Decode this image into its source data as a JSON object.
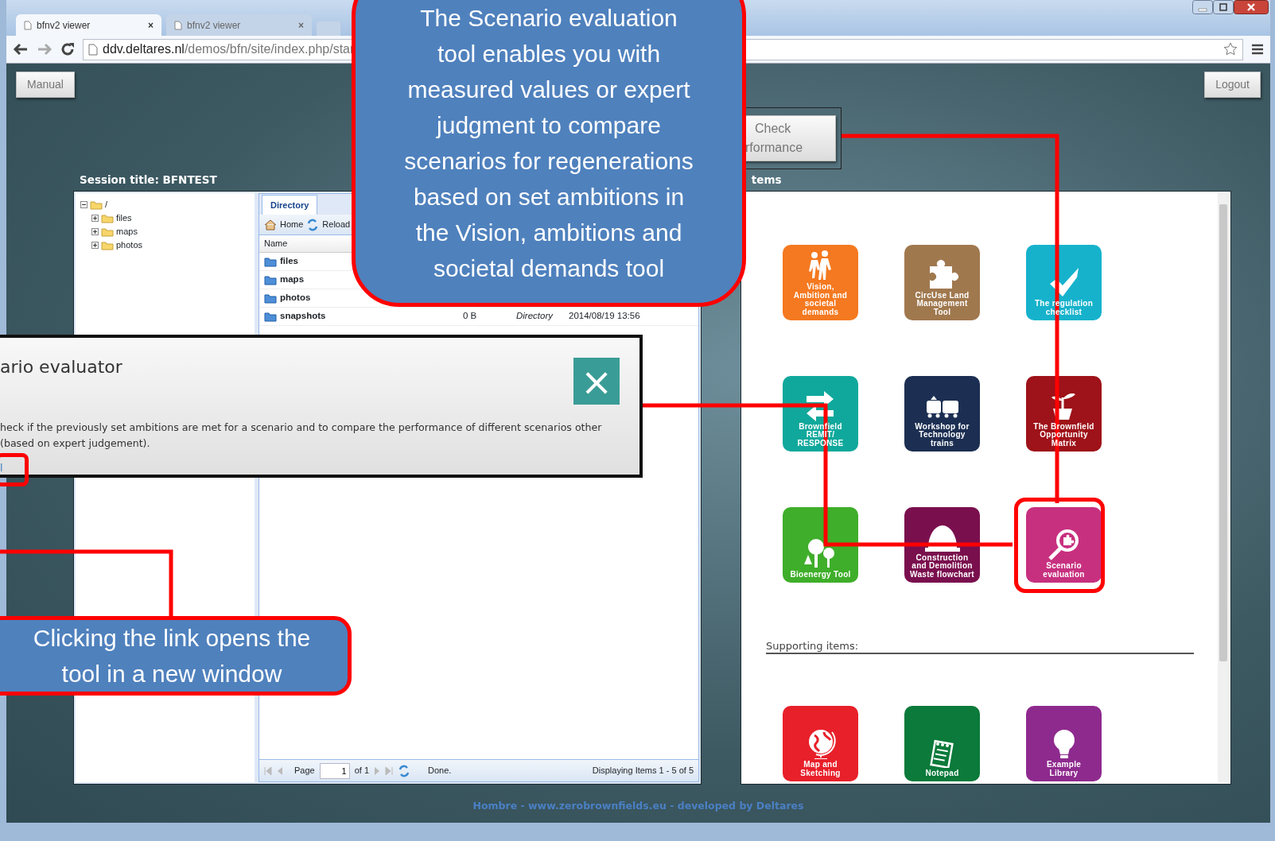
{
  "browser": {
    "tabs": [
      {
        "title": "bfnv2 viewer",
        "close": "×",
        "selected": true
      },
      {
        "title": "bfnv2 viewer",
        "close": "×",
        "selected": false
      }
    ],
    "url_host": "ddv.deltares.nl",
    "url_path": "/demos/bfn/site/index.php/star"
  },
  "header": {
    "manual": "Manual",
    "logout": "Logout",
    "check_performance": [
      "Check",
      "rformance"
    ]
  },
  "session_title": "Session title: BFNTEST",
  "items_heading": "tems",
  "tree": {
    "label": "/",
    "expanded": true,
    "children": [
      {
        "label": "files",
        "expanded": false
      },
      {
        "label": "maps",
        "expanded": false
      },
      {
        "label": "photos",
        "expanded": false
      }
    ]
  },
  "directory": {
    "tab": "Directory",
    "toolbar": [
      "Home",
      "Reload"
    ],
    "column": "Name",
    "rows": [
      {
        "name": "files"
      },
      {
        "name": "maps"
      },
      {
        "name": "photos"
      },
      {
        "name": "snapshots",
        "size": "0 B",
        "type": "Directory",
        "date": "2014/08/19 13:56"
      }
    ],
    "pager": {
      "page_label": "Page",
      "page": "1",
      "of": "of 1",
      "status": "Done.",
      "display": "Displaying Items 1 - 5 of 5"
    }
  },
  "tools": [
    {
      "label": "Vision, Ambition and societal demands",
      "kind": "walkers",
      "color": "#f47920",
      "highlighted": false
    },
    {
      "label": "CircUse Land Management Tool",
      "kind": "puzzle",
      "color": "#a0784e",
      "highlighted": false
    },
    {
      "label": "The regulation checklist",
      "kind": "check",
      "color": "#16b2cc",
      "highlighted": false
    },
    {
      "label": "Brownfield REMIT/ RESPONSE",
      "kind": "arrows",
      "color": "#10a89c",
      "highlighted": false
    },
    {
      "label": "Workshop for Technology trains",
      "kind": "train",
      "color": "#1c2f52",
      "highlighted": false
    },
    {
      "label": "The Brownfield Opportunity Matrix",
      "kind": "sprout",
      "color": "#9e1219",
      "highlighted": false
    },
    {
      "label": "Bioenergy Tool",
      "kind": "trees",
      "color": "#3fae2a",
      "highlighted": false
    },
    {
      "label": "Construction and Demolition Waste flowchart",
      "kind": "helmet",
      "color": "#7a0f4e",
      "highlighted": false
    },
    {
      "label": "Scenario evaluation",
      "kind": "magnifier",
      "color": "#c7307f",
      "highlighted": true
    }
  ],
  "supporting_heading": "Supporting items:",
  "supporting": [
    {
      "label": "Map and Sketching",
      "kind": "globe",
      "color": "#e8202a"
    },
    {
      "label": "Notepad",
      "kind": "notepad",
      "color": "#0b7a3a"
    },
    {
      "label": "Example Library",
      "kind": "bulb",
      "color": "#8e2a8e"
    }
  ],
  "footer": "Hombre - www.zerobrownfields.eu - developed by Deltares",
  "dialog": {
    "title": "ario evaluator",
    "close": "×",
    "text": "heck if the previously set ambitions are met for a scenario and to compare the performance of different scenarios other (based on expert judgement).",
    "link": "l"
  },
  "callouts": [
    {
      "text": "The Scenario evaluation tool enables you with measured values or expert judgment to compare scenarios for regenerations based on set ambitions in the Vision, ambitions and societal demands tool"
    },
    {
      "text": "Clicking the link opens the tool in a new window"
    }
  ]
}
